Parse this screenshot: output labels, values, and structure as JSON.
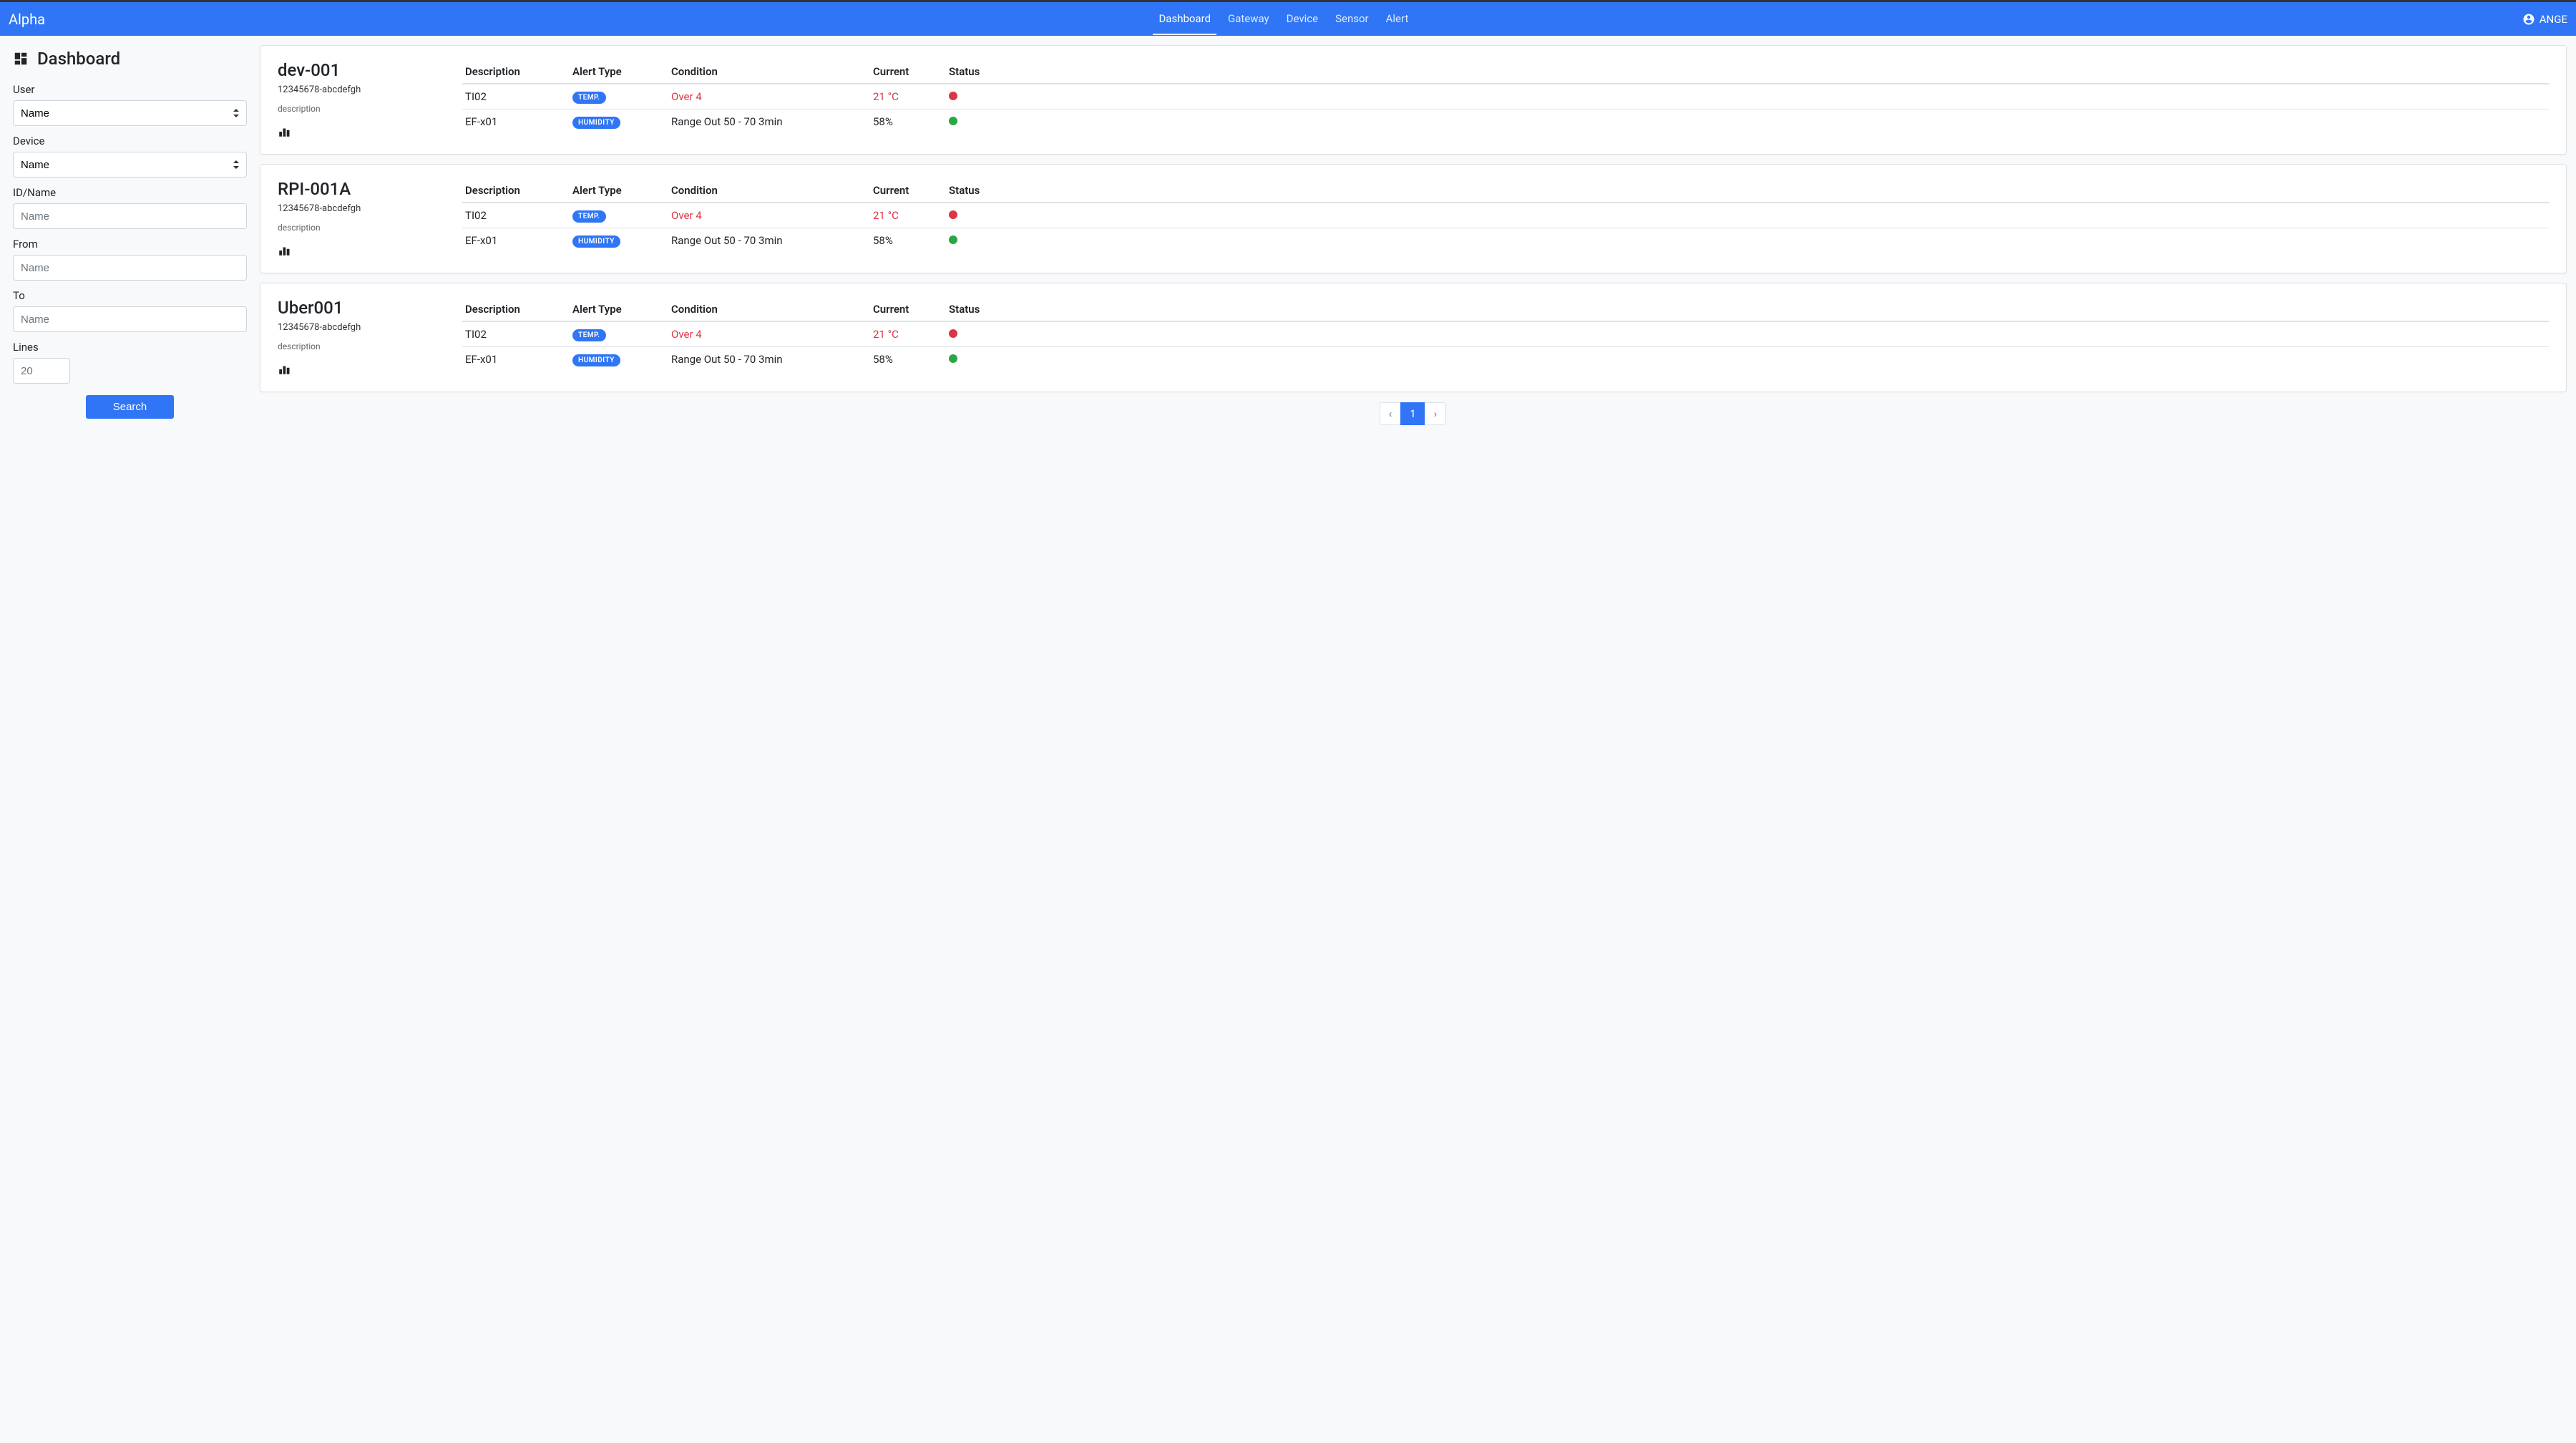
{
  "brand": "Alpha",
  "nav": {
    "items": [
      "Dashboard",
      "Gateway",
      "Device",
      "Sensor",
      "Alert"
    ],
    "active": "Dashboard"
  },
  "user": "ANGE",
  "sidebar": {
    "title": "Dashboard",
    "userLabel": "User",
    "userOption": "Name",
    "deviceLabel": "Device",
    "deviceOption": "Name",
    "idNameLabel": "ID/Name",
    "idNamePlaceholder": "Name",
    "fromLabel": "From",
    "fromPlaceholder": "Name",
    "toLabel": "To",
    "toPlaceholder": "Name",
    "linesLabel": "Lines",
    "linesPlaceholder": "20",
    "searchLabel": "Search"
  },
  "tableHeaders": {
    "description": "Description",
    "alertType": "Alert Type",
    "condition": "Condition",
    "current": "Current",
    "status": "Status"
  },
  "devices": [
    {
      "name": "dev-001",
      "id": "12345678-abcdefgh",
      "desc": "description",
      "alerts": [
        {
          "desc": "TI02",
          "type": "Temp.",
          "condition": "Over 4",
          "conditionDanger": true,
          "current": "21 °C",
          "currentDanger": true,
          "status": "red"
        },
        {
          "desc": "EF-x01",
          "type": "Humidity",
          "condition": "Range Out 50 - 70 3min",
          "conditionDanger": false,
          "current": "58%",
          "currentDanger": false,
          "status": "green"
        }
      ]
    },
    {
      "name": "RPI-001A",
      "id": "12345678-abcdefgh",
      "desc": "description",
      "alerts": [
        {
          "desc": "TI02",
          "type": "Temp.",
          "condition": "Over 4",
          "conditionDanger": true,
          "current": "21 °C",
          "currentDanger": true,
          "status": "red"
        },
        {
          "desc": "EF-x01",
          "type": "Humidity",
          "condition": "Range Out 50 - 70 3min",
          "conditionDanger": false,
          "current": "58%",
          "currentDanger": false,
          "status": "green"
        }
      ]
    },
    {
      "name": "Uber001",
      "id": "12345678-abcdefgh",
      "desc": "description",
      "alerts": [
        {
          "desc": "TI02",
          "type": "Temp.",
          "condition": "Over 4",
          "conditionDanger": true,
          "current": "21 °C",
          "currentDanger": true,
          "status": "red"
        },
        {
          "desc": "EF-x01",
          "type": "Humidity",
          "condition": "Range Out 50 - 70 3min",
          "conditionDanger": false,
          "current": "58%",
          "currentDanger": false,
          "status": "green"
        }
      ]
    }
  ],
  "pagination": {
    "prev": "‹",
    "current": "1",
    "next": "›"
  }
}
